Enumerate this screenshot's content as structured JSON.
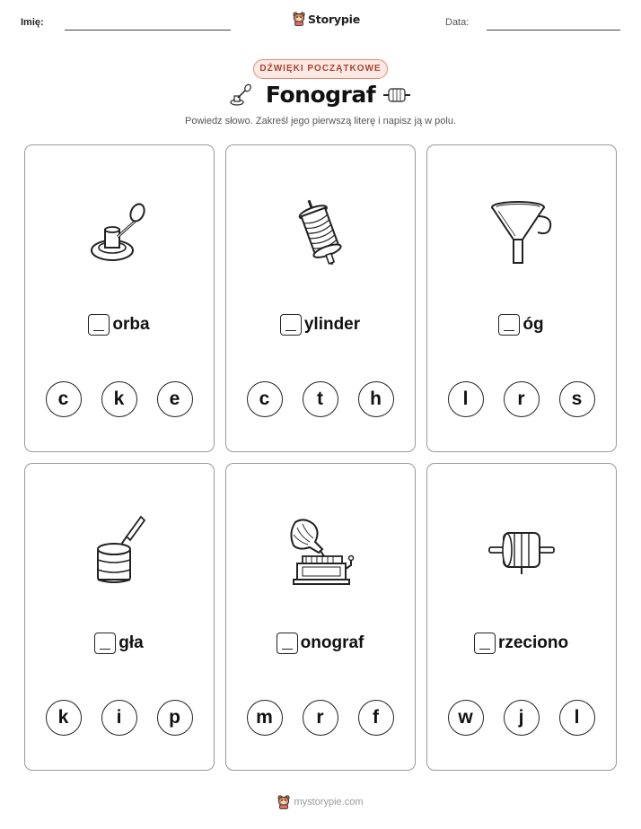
{
  "header": {
    "name_label": "Imię:",
    "date_label": "Data:",
    "brand": "Storypie"
  },
  "badge": "DŹWIĘKI POCZĄTKOWE",
  "title": "Fonograf",
  "instructions": "Powiedz słowo. Zakreśl jego pierwszą literę i napisz ją w polu.",
  "cards": [
    {
      "icon": "crank-handle-icon",
      "word": "orba",
      "choices": [
        "c",
        "k",
        "e"
      ]
    },
    {
      "icon": "thread-spool-icon",
      "word": "ylinder",
      "choices": [
        "c",
        "t",
        "h"
      ]
    },
    {
      "icon": "funnel-icon",
      "word": "óg",
      "choices": [
        "l",
        "r",
        "s"
      ]
    },
    {
      "icon": "wax-cylinder-needle-icon",
      "word": "gła",
      "choices": [
        "k",
        "i",
        "p"
      ]
    },
    {
      "icon": "phonograph-icon",
      "word": "onograf",
      "choices": [
        "m",
        "r",
        "f"
      ]
    },
    {
      "icon": "roller-cylinder-icon",
      "word": "rzeciono",
      "choices": [
        "w",
        "j",
        "l"
      ]
    }
  ],
  "footer": {
    "site": "mystorypie.com"
  }
}
